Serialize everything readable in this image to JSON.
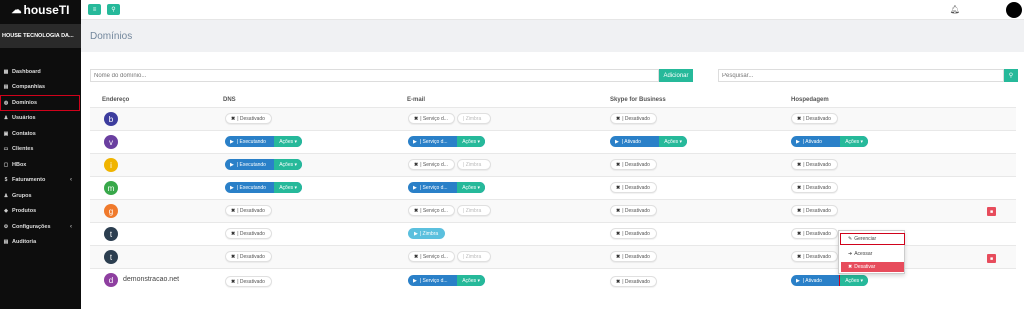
{
  "brand": {
    "name": "houseTI",
    "company": "HOUSE TECNOLOGIA DA..."
  },
  "sidebar": {
    "items": [
      {
        "label": "Dashboard",
        "icon": "dashboard-icon",
        "glyph": "▦"
      },
      {
        "label": "Companhias",
        "icon": "building-icon",
        "glyph": "▤"
      },
      {
        "label": "Domínios",
        "icon": "globe-icon",
        "glyph": "◍"
      },
      {
        "label": "Usuários",
        "icon": "user-icon",
        "glyph": "♟"
      },
      {
        "label": "Contatos",
        "icon": "contacts-icon",
        "glyph": "▣"
      },
      {
        "label": "Clientes",
        "icon": "clients-icon",
        "glyph": "▭"
      },
      {
        "label": "HBox",
        "icon": "box-icon",
        "glyph": "▢"
      },
      {
        "label": "Faturamento",
        "icon": "billing-icon",
        "glyph": "$"
      },
      {
        "label": "Grupos",
        "icon": "groups-icon",
        "glyph": "♟"
      },
      {
        "label": "Produtos",
        "icon": "products-icon",
        "glyph": "◆"
      },
      {
        "label": "Configurações",
        "icon": "gear-icon",
        "glyph": "⚙"
      },
      {
        "label": "Auditoria",
        "icon": "audit-icon",
        "glyph": "▤"
      }
    ]
  },
  "page": {
    "title": "Domínios"
  },
  "toolbar": {
    "domain_placeholder": "Nome do domínio...",
    "add_label": "Adicionar",
    "search_placeholder": "Pesquisar..."
  },
  "table": {
    "headers": [
      "Endereço",
      "DNS",
      "E-mail",
      "Skype for Business",
      "Hospedagem"
    ],
    "rows": [
      {
        "letter": "b",
        "color": "#3d3d9e",
        "domain": ""
      },
      {
        "letter": "v",
        "color": "#6a3fa0",
        "domain": ""
      },
      {
        "letter": "i",
        "color": "#f0b400",
        "domain": ""
      },
      {
        "letter": "m",
        "color": "#38a84a",
        "domain": ""
      },
      {
        "letter": "g",
        "color": "#f07a2c",
        "domain": ""
      },
      {
        "letter": "t",
        "color": "#2c3e50",
        "domain": ""
      },
      {
        "letter": "t",
        "color": "#2c3e50",
        "domain": ""
      },
      {
        "letter": "d",
        "color": "#8e3fa0",
        "domain": "demonstracao.net"
      }
    ]
  },
  "status": {
    "desativado": "| Desativado",
    "executando": "| Executando",
    "servico": "| Serviço d...",
    "zimbra": "| Zimbra",
    "ativado": "| Ativado",
    "acoes": "Ações ▾",
    "x": "✖",
    "play": "▶"
  },
  "dropdown": {
    "gerenciar": "Gerenciar",
    "acessar": "Acessar",
    "desativar": "Desativar"
  },
  "colors": {
    "accent": "#26b99a",
    "primary": "#2a80c8",
    "danger": "#e74c5c",
    "highlight": "#d0021b"
  }
}
